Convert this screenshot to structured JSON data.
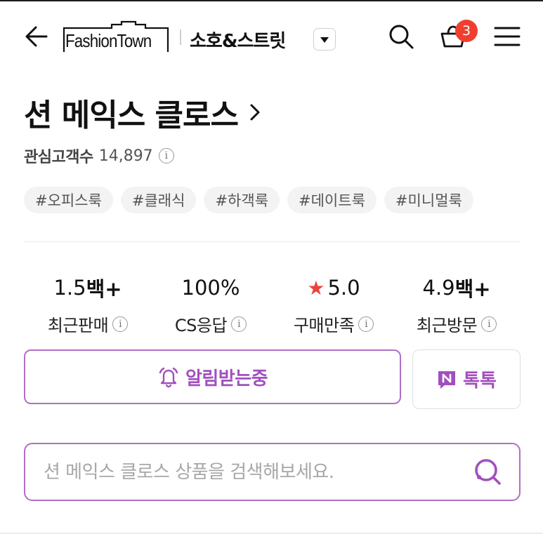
{
  "header": {
    "logo_text": "FashionTown",
    "category_label": "소호&스트릿",
    "cart_count": "3",
    "icons": {
      "back": "arrow-left-icon",
      "dropdown": "caret-down-icon",
      "search": "search-icon",
      "cart": "shopping-basket-icon",
      "menu": "hamburger-menu-icon"
    }
  },
  "store": {
    "name": "션 메익스 클로스",
    "interest_label": "관심고객수",
    "interest_count": "14,897",
    "tags": [
      "#오피스룩",
      "#클래식",
      "#하객룩",
      "#데이트룩",
      "#미니멀룩"
    ]
  },
  "stats": [
    {
      "value": "1.5",
      "suffix": "백+",
      "label": "최근판매"
    },
    {
      "value": "100%",
      "suffix": "",
      "label": "CS응답"
    },
    {
      "value": "5.0",
      "suffix": "",
      "label": "구매만족",
      "icon": "star-icon"
    },
    {
      "value": "4.9",
      "suffix": "백+",
      "label": "최근방문"
    }
  ],
  "actions": {
    "notify_label": "알림받는중",
    "talk_label": "톡톡",
    "notify_icon": "bell-icon",
    "talk_icon": "naver-talk-icon"
  },
  "search": {
    "placeholder": "션 메익스 클로스 상품을 검색해보세요.",
    "value": ""
  },
  "colors": {
    "accent": "#a24fbe",
    "accent_border": "#b06fc8",
    "badge": "#f03e2f",
    "star": "#e8453c"
  }
}
